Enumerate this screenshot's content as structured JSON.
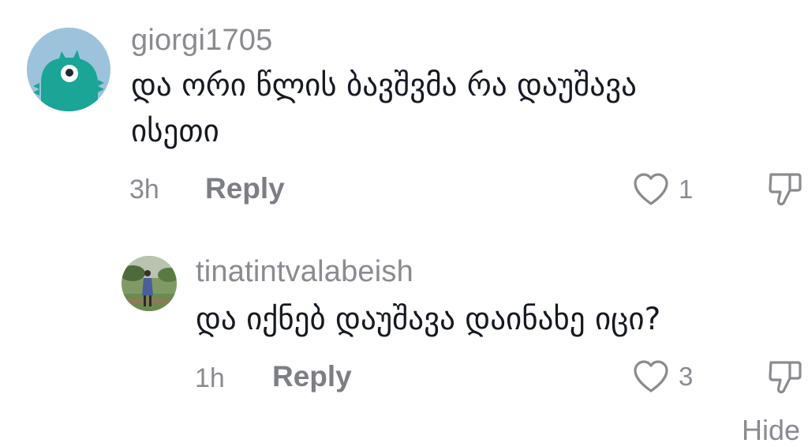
{
  "comments": [
    {
      "username": "giorgi1705",
      "text_line1": "და ორი წლის ბავშვმა რა დაუშავა",
      "text_line2": "ისეთი",
      "time": "3h",
      "reply_label": "Reply",
      "likes": "1",
      "avatar_color": "#9dc3dc",
      "avatar_figure_color": "#1aa596"
    },
    {
      "username": "tinatintvalabeish",
      "text_line1": "და იქნებ დაუშავა დაინახე იცი?",
      "time": "1h",
      "reply_label": "Reply",
      "likes": "3"
    }
  ],
  "footer": {
    "hide_label": "Hide"
  },
  "colors": {
    "muted": "#8a8b91",
    "text": "#161823"
  }
}
